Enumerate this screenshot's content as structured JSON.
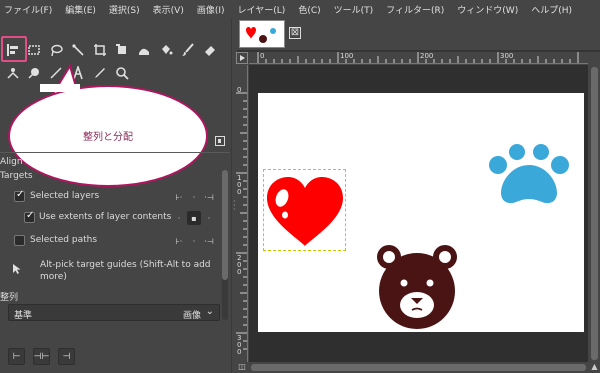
{
  "menubar": {
    "items": [
      "ファイル(F)",
      "編集(E)",
      "選択(S)",
      "表示(V)",
      "画像(I)",
      "レイヤー(L)",
      "色(C)",
      "ツール(T)",
      "フィルター(R)",
      "ウィンドウ(W)",
      "ヘルプ(H)"
    ]
  },
  "toolbox": {
    "active_tool": "align-tool",
    "highlight_color": "#e24d87",
    "callout_text": "整列と分配"
  },
  "tool_options": {
    "title": "Align",
    "targets_heading": "Targets",
    "selected_layers": {
      "label": "Selected layers",
      "checked": true
    },
    "use_extents": {
      "label": "Use extents of layer contents",
      "checked": true
    },
    "selected_paths": {
      "label": "Selected paths",
      "checked": false
    },
    "alt_pick_text": "Alt-pick target guides (Shift-Alt to add more)",
    "align_heading": "整列",
    "reference": {
      "label": "基準",
      "value": "画像"
    }
  },
  "rulers": {
    "h_labels": [
      "0",
      "100",
      "200",
      "300"
    ],
    "v_labels": [
      "0",
      "1 0 0",
      "2 0 0",
      "3 0 0"
    ]
  },
  "image_tab": {
    "close_symbol": "⊠"
  },
  "colors": {
    "heart": "#ff0000",
    "paw": "#3aa8d8",
    "bear": "#4a1414",
    "callout_border": "#b0155f"
  }
}
